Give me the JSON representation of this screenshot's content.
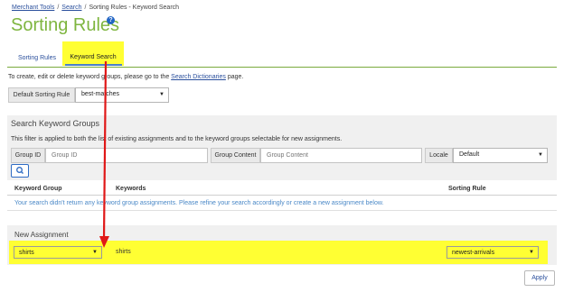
{
  "breadcrumb": {
    "items": [
      "Merchant Tools",
      "Search",
      "Sorting Rules - Keyword Search"
    ],
    "separator": "/"
  },
  "page": {
    "title": "Sorting Rules",
    "help": "?"
  },
  "tabs": [
    {
      "label": "Sorting Rules",
      "active": false
    },
    {
      "label": "Keyword Search",
      "active": true
    }
  ],
  "intro": {
    "text_before": "To create, edit or delete keyword groups, please go to the ",
    "link": "Search Dictionaries",
    "text_after": " page."
  },
  "default_sorting": {
    "label": "Default Sorting Rule",
    "value": "best-matches"
  },
  "search_panel": {
    "title": "Search Keyword Groups",
    "description": "This filter is applied to both the list of existing assignments and to the keyword groups selectable for new assignments.",
    "group_id": {
      "label": "Group ID",
      "placeholder": "Group ID"
    },
    "group_content": {
      "label": "Group Content",
      "placeholder": "Group Content"
    },
    "locale": {
      "label": "Locale",
      "value": "Default"
    }
  },
  "table": {
    "columns": [
      "Keyword Group",
      "Keywords",
      "Sorting Rule"
    ],
    "empty_message": "Your search didn't return any keyword group assignments. Please refine your search accordingly or create a new assignment below."
  },
  "new_assignment": {
    "title": "New Assignment",
    "keyword_group": "shirts",
    "keywords": "shirts",
    "sorting_rule": "newest-arrivals"
  },
  "apply_label": "Apply",
  "colors": {
    "title_green": "#7eb53f",
    "highlight_yellow": "#ffff33",
    "annotation_red": "#e01818",
    "link_blue": "#2a4f9c"
  },
  "icons": {
    "search": "magnifier-icon",
    "caret": "caret-down-icon",
    "help": "help-circle-icon"
  }
}
